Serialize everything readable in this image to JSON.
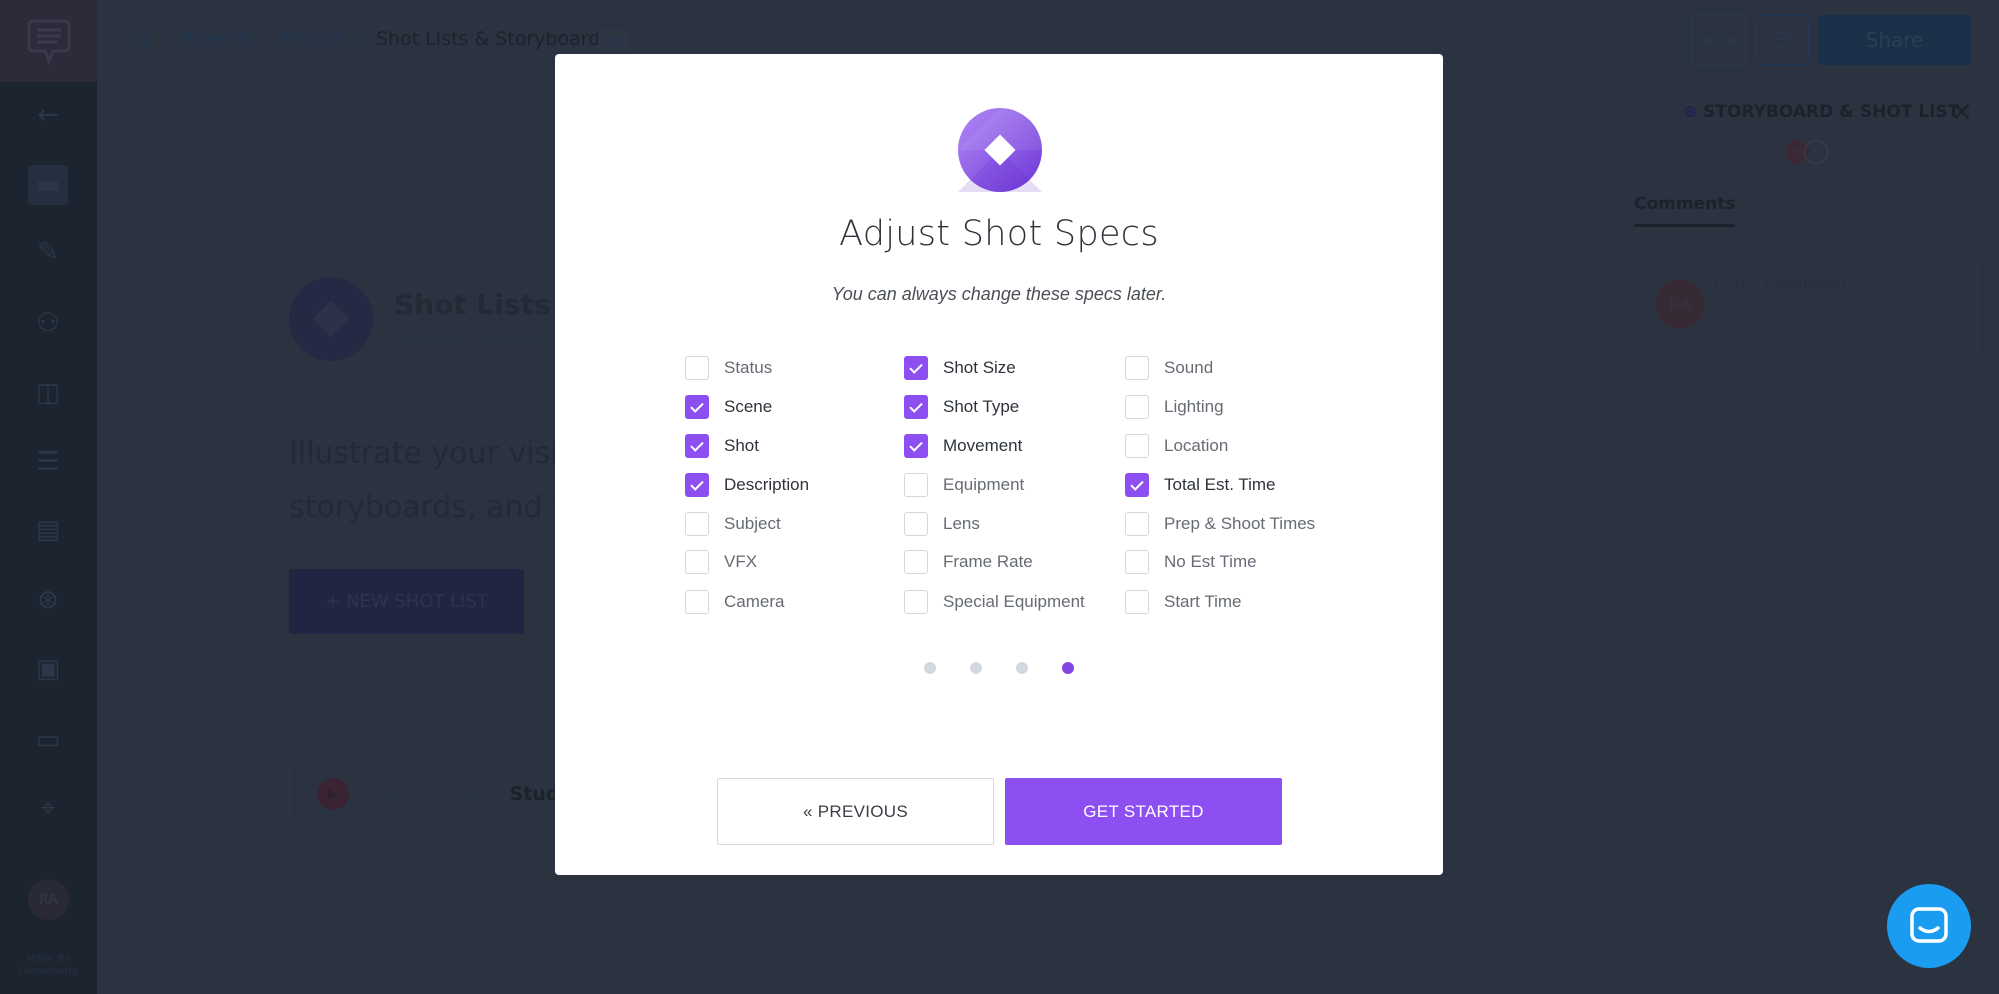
{
  "sidebar": {
    "avatar": "RA",
    "credit_line1": "Made By",
    "credit_line2": "Leanometry"
  },
  "header": {
    "breadcrumb": [
      "Projects",
      "Project 1",
      "Shot Lists & Storyboards"
    ],
    "version": "v0",
    "share_label": "Share"
  },
  "page": {
    "title": "Shot Lists &",
    "subtitle": "Prepare and show",
    "body_line1": "Illustrate your vision",
    "body_line2": "storyboards, and full",
    "new_button": "+ NEW SHOT LIST",
    "explore_prefix": "Explore related ",
    "explore_bold": "Studi"
  },
  "right_panel": {
    "title": "STORYBOARD & SHOT LIST",
    "avatar": "RA",
    "tabs": [
      "Comments",
      "Tasks"
    ],
    "active_tab": "Comments",
    "comment_placeholder": "Enter Comment...",
    "comment_avatar": "RA"
  },
  "modal": {
    "title": "Adjust Shot Specs",
    "subtitle": "You can always change these specs later.",
    "columns": [
      [
        {
          "label": "Status",
          "checked": false
        },
        {
          "label": "Scene",
          "checked": true
        },
        {
          "label": "Shot",
          "checked": true
        },
        {
          "label": "Description",
          "checked": true
        },
        {
          "label": "Subject",
          "checked": false
        },
        {
          "label": "VFX",
          "checked": false
        },
        {
          "label": "Camera",
          "checked": false
        }
      ],
      [
        {
          "label": "Shot Size",
          "checked": true
        },
        {
          "label": "Shot Type",
          "checked": true
        },
        {
          "label": "Movement",
          "checked": true
        },
        {
          "label": "Equipment",
          "checked": false
        },
        {
          "label": "Lens",
          "checked": false
        },
        {
          "label": "Frame Rate",
          "checked": false
        },
        {
          "label": "Special Equipment",
          "checked": false
        }
      ],
      [
        {
          "label": "Sound",
          "checked": false
        },
        {
          "label": "Lighting",
          "checked": false
        },
        {
          "label": "Location",
          "checked": false
        },
        {
          "label": "Total Est. Time",
          "checked": true
        },
        {
          "label": "Prep & Shoot Times",
          "checked": false
        },
        {
          "label": "No Est Time",
          "checked": false
        },
        {
          "label": "Start Time",
          "checked": false
        }
      ]
    ],
    "steps": {
      "total": 4,
      "current": 4
    },
    "prev_label": "« PREVIOUS",
    "start_label": "GET STARTED",
    "accent": "#8e4ff2"
  }
}
